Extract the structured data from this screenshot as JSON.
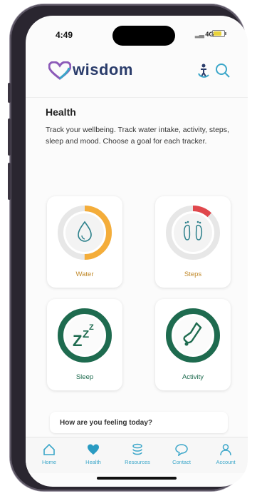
{
  "status_bar": {
    "time": "4:49",
    "network": "4G"
  },
  "header": {
    "brand": "wisdom"
  },
  "health": {
    "title": "Health",
    "description": "Track your wellbeing. Track water intake, activity, steps, sleep and mood. Choose a goal for each tracker."
  },
  "trackers": [
    {
      "label": "Water",
      "progress": 0.5,
      "color": "#f4ad3a",
      "icon": "water-drop-icon"
    },
    {
      "label": "Steps",
      "progress": 0.12,
      "color": "#e0474c",
      "icon": "footprints-icon"
    },
    {
      "label": "Sleep",
      "progress": 1.0,
      "color": "#1e6b4f",
      "icon": "sleep-zzz-icon"
    },
    {
      "label": "Activity",
      "progress": 1.0,
      "color": "#1e6b4f",
      "icon": "activity-shoe-icon"
    }
  ],
  "mood_prompt": "How are you feeling today?",
  "tabs": [
    {
      "label": "Home",
      "icon": "home-icon"
    },
    {
      "label": "Health",
      "icon": "heart-icon"
    },
    {
      "label": "Resources",
      "icon": "layers-icon"
    },
    {
      "label": "Contact",
      "icon": "chat-bubble-icon"
    },
    {
      "label": "Account",
      "icon": "person-icon"
    }
  ],
  "colors": {
    "brand_text": "#2a3c6b",
    "accent": "#3aa6c9",
    "water": "#f4ad3a",
    "steps": "#e0474c",
    "green": "#1e6b4f"
  }
}
